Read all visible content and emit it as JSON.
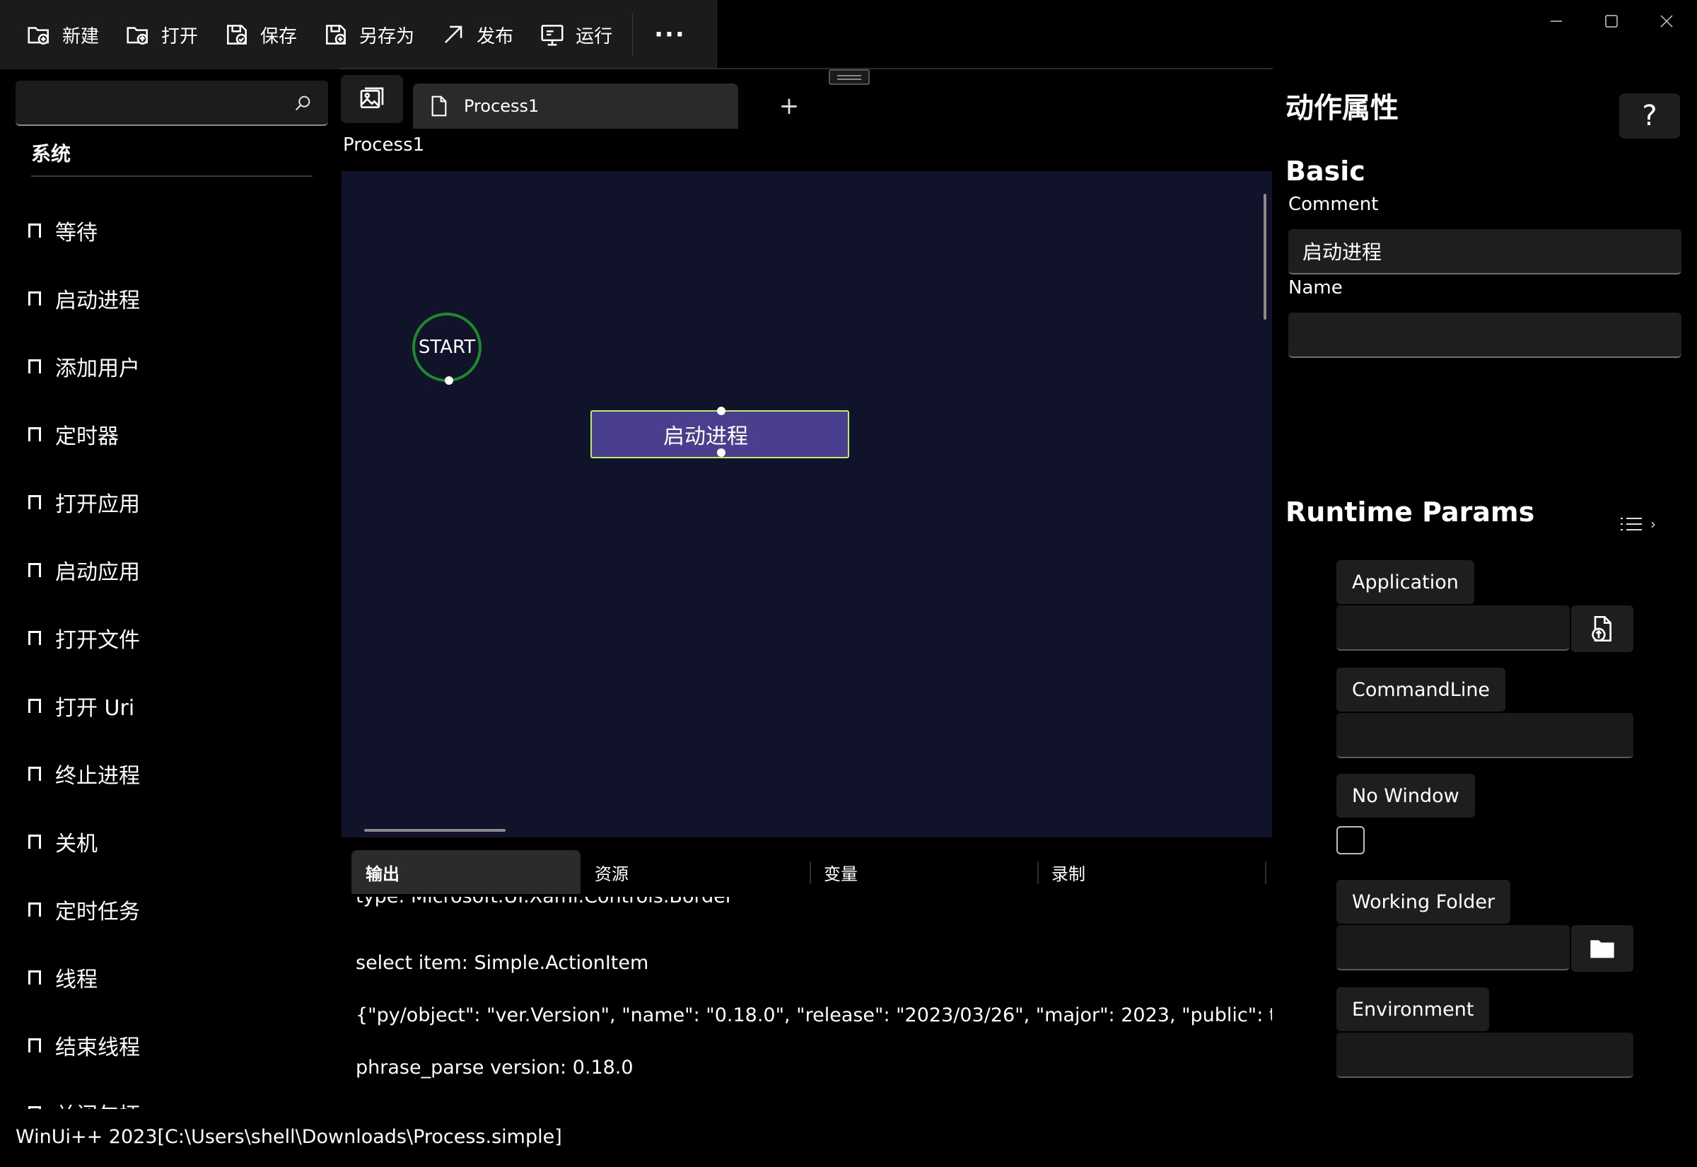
{
  "toolbar": {
    "new_label": "新建",
    "open_label": "打开",
    "save_label": "保存",
    "save_as_label": "另存为",
    "publish_label": "发布",
    "run_label": "运行",
    "more_label": "···"
  },
  "sidebar": {
    "search": {
      "value": "",
      "placeholder": ""
    },
    "category": "系统",
    "items": [
      {
        "label": "等待"
      },
      {
        "label": "启动进程"
      },
      {
        "label": "添加用户"
      },
      {
        "label": "定时器"
      },
      {
        "label": "打开应用"
      },
      {
        "label": "启动应用"
      },
      {
        "label": "打开文件"
      },
      {
        "label": "打开 Uri"
      },
      {
        "label": "终止进程"
      },
      {
        "label": "关机"
      },
      {
        "label": "定时任务"
      },
      {
        "label": "线程"
      },
      {
        "label": "结束线程"
      },
      {
        "label": "关闭句柄"
      }
    ]
  },
  "canvas": {
    "tab_label": "Process1",
    "add_tab_label": "+",
    "breadcrumb": "Process1",
    "start_node_label": "START",
    "action_node_label": "启动进程"
  },
  "output": {
    "tabs": [
      {
        "label": "输出"
      },
      {
        "label": "资源"
      },
      {
        "label": "变量"
      },
      {
        "label": "录制"
      }
    ],
    "lines": [
      "type: Microsoft.UI.Xaml.Controls.Border",
      "select item: Simple.ActionItem",
      "{\"py/object\": \"ver.Version\", \"name\": \"0.18.0\", \"release\": \"2023/03/26\", \"major\": 2023, \"public\": true, \"times",
      "phrase_parse version: 0.18.0"
    ]
  },
  "properties": {
    "title": "动作属性",
    "help_label": "?",
    "basic": {
      "title": "Basic",
      "comment_label": "Comment",
      "comment_value": "启动进程",
      "name_label": "Name",
      "name_value": ""
    },
    "runtime": {
      "title": "Runtime Params",
      "expand_label": "›",
      "application_label": "Application",
      "commandline_label": "CommandLine",
      "no_window_label": "No Window",
      "no_window_checked": false,
      "working_folder_label": "Working Folder",
      "environment_label": "Environment"
    }
  },
  "status": {
    "text": "WinUi++ 2023[C:\\Users\\shell\\Downloads\\Process.simple]"
  },
  "colors": {
    "canvas_bg": "#11132a",
    "action_node_fill": "#4a3f8e",
    "action_node_border": "#b8f06a",
    "start_node_border": "#1d8a2a"
  }
}
